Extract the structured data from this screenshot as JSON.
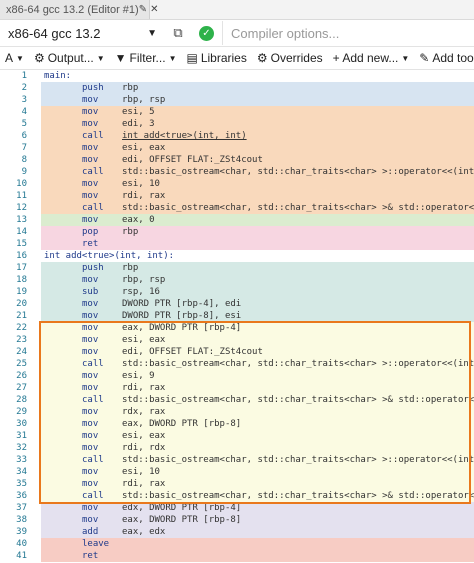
{
  "tab": {
    "title": "x86-64 gcc 13.2 (Editor #1)",
    "icons": [
      "pencil-icon",
      "close-icon"
    ]
  },
  "compiler": {
    "name": "x86-64 gcc 13.2",
    "options_placeholder": "Compiler options..."
  },
  "toolbar": [
    {
      "name": "A-font-button",
      "label": "A",
      "icon": "font-icon",
      "caret": true
    },
    {
      "name": "output-button",
      "label": "Output...",
      "icon": "gear-icon",
      "caret": true
    },
    {
      "name": "filter-button",
      "label": "Filter...",
      "icon": "funnel-icon",
      "caret": true
    },
    {
      "name": "libraries-button",
      "label": "Libraries",
      "icon": "book-icon",
      "caret": false
    },
    {
      "name": "overrides-button",
      "label": "Overrides",
      "icon": "gear-icon",
      "caret": false
    },
    {
      "name": "add-new-button",
      "label": "+ Add new...",
      "icon": "",
      "caret": true
    },
    {
      "name": "add-tool-button",
      "label": "Add tool...",
      "icon": "wrench-icon",
      "caret": true
    }
  ],
  "colors": {
    "orange": "#f9d9bc",
    "blue": "#d7e4f1",
    "mauve": "#f7d6e1",
    "green": "#dbeccf",
    "teal": "#d5e9e5",
    "yellow": "#fbfbe2",
    "lavender": "#e4e1ef",
    "salmon": "#f7ccc4",
    "highlight_border": "#e9781c"
  },
  "lines": [
    {
      "n": "1",
      "label": "main:",
      "op": "",
      "args": "",
      "bg": "white"
    },
    {
      "n": "2",
      "label": "",
      "op": "push",
      "args": "rbp",
      "bg": "blue"
    },
    {
      "n": "3",
      "label": "",
      "op": "mov",
      "args": "rbp, rsp",
      "bg": "blue"
    },
    {
      "n": "4",
      "label": "",
      "op": "mov",
      "args": "esi, 5",
      "bg": "orange"
    },
    {
      "n": "5",
      "label": "",
      "op": "mov",
      "args": "edi, 3",
      "bg": "orange"
    },
    {
      "n": "6",
      "label": "",
      "op": "call",
      "args": "int add<true>(int, int)",
      "bg": "orange",
      "underline": true
    },
    {
      "n": "7",
      "label": "",
      "op": "mov",
      "args": "esi, eax",
      "bg": "orange"
    },
    {
      "n": "8",
      "label": "",
      "op": "mov",
      "args": "edi, OFFSET FLAT:_ZSt4cout",
      "bg": "orange"
    },
    {
      "n": "9",
      "label": "",
      "op": "call",
      "args": "std::basic_ostream<char, std::char_traits<char> >::operator<<(int)",
      "bg": "orange"
    },
    {
      "n": "10",
      "label": "",
      "op": "mov",
      "args": "esi, 10",
      "bg": "orange"
    },
    {
      "n": "11",
      "label": "",
      "op": "mov",
      "args": "rdi, rax",
      "bg": "orange"
    },
    {
      "n": "12",
      "label": "",
      "op": "call",
      "args": "std::basic_ostream<char, std::char_traits<char> >& std::operator<< <std:",
      "bg": "orange"
    },
    {
      "n": "13",
      "label": "",
      "op": "mov",
      "args": "eax, 0",
      "bg": "green"
    },
    {
      "n": "14",
      "label": "",
      "op": "pop",
      "args": "rbp",
      "bg": "mauve"
    },
    {
      "n": "15",
      "label": "",
      "op": "ret",
      "args": "",
      "bg": "mauve"
    },
    {
      "n": "16",
      "label": "int add<true>(int, int):",
      "op": "",
      "args": "",
      "bg": "white"
    },
    {
      "n": "17",
      "label": "",
      "op": "push",
      "args": "rbp",
      "bg": "teal"
    },
    {
      "n": "18",
      "label": "",
      "op": "mov",
      "args": "rbp, rsp",
      "bg": "teal"
    },
    {
      "n": "19",
      "label": "",
      "op": "sub",
      "args": "rsp, 16",
      "bg": "teal"
    },
    {
      "n": "20",
      "label": "",
      "op": "mov",
      "args": "DWORD PTR [rbp-4], edi",
      "bg": "teal"
    },
    {
      "n": "21",
      "label": "",
      "op": "mov",
      "args": "DWORD PTR [rbp-8], esi",
      "bg": "teal"
    },
    {
      "n": "22",
      "label": "",
      "op": "mov",
      "args": "eax, DWORD PTR [rbp-4]",
      "bg": "yellow"
    },
    {
      "n": "23",
      "label": "",
      "op": "mov",
      "args": "esi, eax",
      "bg": "yellow"
    },
    {
      "n": "24",
      "label": "",
      "op": "mov",
      "args": "edi, OFFSET FLAT:_ZSt4cout",
      "bg": "yellow"
    },
    {
      "n": "25",
      "label": "",
      "op": "call",
      "args": "std::basic_ostream<char, std::char_traits<char> >::operator<<(int)",
      "bg": "yellow"
    },
    {
      "n": "26",
      "label": "",
      "op": "mov",
      "args": "esi, 9",
      "bg": "yellow"
    },
    {
      "n": "27",
      "label": "",
      "op": "mov",
      "args": "rdi, rax",
      "bg": "yellow"
    },
    {
      "n": "28",
      "label": "",
      "op": "call",
      "args": "std::basic_ostream<char, std::char_traits<char> >& std::operator<< <std:",
      "bg": "yellow"
    },
    {
      "n": "29",
      "label": "",
      "op": "mov",
      "args": "rdx, rax",
      "bg": "yellow"
    },
    {
      "n": "30",
      "label": "",
      "op": "mov",
      "args": "eax, DWORD PTR [rbp-8]",
      "bg": "yellow"
    },
    {
      "n": "31",
      "label": "",
      "op": "mov",
      "args": "esi, eax",
      "bg": "yellow"
    },
    {
      "n": "32",
      "label": "",
      "op": "mov",
      "args": "rdi, rdx",
      "bg": "yellow"
    },
    {
      "n": "33",
      "label": "",
      "op": "call",
      "args": "std::basic_ostream<char, std::char_traits<char> >::operator<<(int)",
      "bg": "yellow"
    },
    {
      "n": "34",
      "label": "",
      "op": "mov",
      "args": "esi, 10",
      "bg": "yellow"
    },
    {
      "n": "35",
      "label": "",
      "op": "mov",
      "args": "rdi, rax",
      "bg": "yellow"
    },
    {
      "n": "36",
      "label": "",
      "op": "call",
      "args": "std::basic_ostream<char, std::char_traits<char> >& std::operator<< <std:",
      "bg": "yellow"
    },
    {
      "n": "37",
      "label": "",
      "op": "mov",
      "args": "edx, DWORD PTR [rbp-4]",
      "bg": "lavender"
    },
    {
      "n": "38",
      "label": "",
      "op": "mov",
      "args": "eax, DWORD PTR [rbp-8]",
      "bg": "lavender"
    },
    {
      "n": "39",
      "label": "",
      "op": "add",
      "args": "eax, edx",
      "bg": "lavender"
    },
    {
      "n": "40",
      "label": "",
      "op": "leave",
      "args": "",
      "bg": "salmon"
    },
    {
      "n": "41",
      "label": "",
      "op": "ret",
      "args": "",
      "bg": "salmon"
    }
  ]
}
